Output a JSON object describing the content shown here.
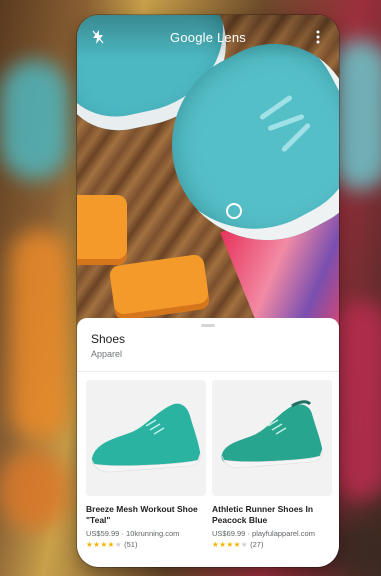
{
  "app": {
    "title": "Google Lens"
  },
  "camera": {
    "flash_icon": "flash-off-icon",
    "menu_icon": "more-vert-icon"
  },
  "result": {
    "title": "Shoes",
    "subtitle": "Apparel"
  },
  "products": [
    {
      "name": "Breeze Mesh Workout Shoe \"Teal\"",
      "price_store": "US$59.99 · 10krunning.com",
      "stars": 4,
      "reviews": "(51)",
      "color": "#2bb3a1"
    },
    {
      "name": "Athletic Runner Shoes In Peacock Blue",
      "price_store": "US$69.99 · playfulapparel.com",
      "stars": 4,
      "reviews": "(27)",
      "color": "#27a58e"
    }
  ],
  "colors": {
    "sheet": "#ffffff",
    "star": "#f4b400",
    "shoe_teal": "#55bfc8"
  }
}
